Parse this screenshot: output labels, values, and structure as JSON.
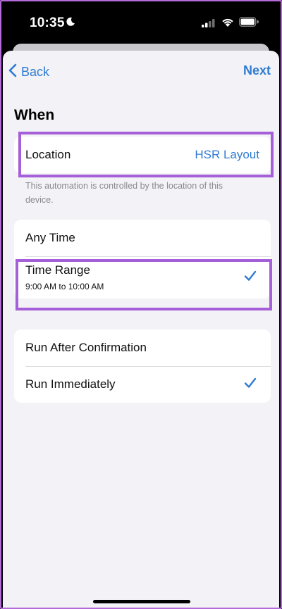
{
  "status_bar": {
    "time": "10:35"
  },
  "nav": {
    "back_label": "Back",
    "next_label": "Next"
  },
  "section": {
    "title": "When"
  },
  "location": {
    "label": "Location",
    "value": "HSR Layout",
    "footnote": "This automation is controlled by the location of this device."
  },
  "time_options": {
    "any_time": "Any Time",
    "time_range": "Time Range",
    "time_range_detail": "9:00 AM to 10:00 AM"
  },
  "run_options": {
    "after_confirmation": "Run After Confirmation",
    "immediately": "Run Immediately"
  },
  "colors": {
    "accent": "#2f7bd2",
    "highlight": "#a55fd8",
    "background": "#f2f2f7"
  },
  "icons": [
    "moon-icon",
    "signal-icon",
    "wifi-icon",
    "battery-icon",
    "chevron-left-icon",
    "checkmark-icon"
  ]
}
